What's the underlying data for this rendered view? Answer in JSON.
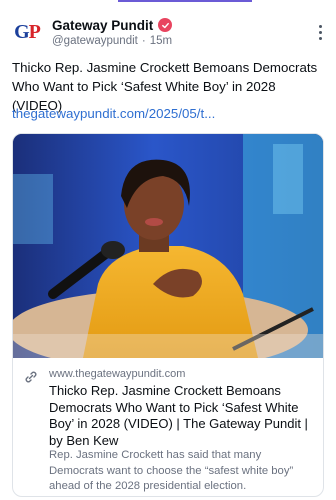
{
  "post": {
    "author_name": "Gateway Pundit",
    "handle": "@gatewaypundit",
    "separator": "·",
    "time": "15m",
    "avatar_letters": {
      "g": "G",
      "p": "P"
    },
    "text": "Thicko Rep. Jasmine Crockett Bemoans Democrats Who Want to Pick ‘Safest White Boy’ in 2028 (VIDEO)",
    "link_text": "thegatewaypundit.com/2025/05/t..."
  },
  "card": {
    "domain": "www.thegatewaypundit.com",
    "title": "Thicko Rep. Jasmine Crockett Bemoans Democrats Who Want to Pick ‘Safest White Boy’ in 2028 (VIDEO) | The Gateway Pundit | by Ben Kew",
    "description": "Rep. Jasmine Crockett has said that many Democrats want to choose the “safest white boy” ahead of the 2028 presidential election."
  },
  "icons": {
    "verified": "verified-badge-icon",
    "more": "more-vertical-icon",
    "link": "link-chain-icon"
  },
  "colors": {
    "link": "#2f6fd1",
    "verified_badge": "#e8445f",
    "accent_bar": "#6b5bd6",
    "muted_text": "#6b7280"
  }
}
